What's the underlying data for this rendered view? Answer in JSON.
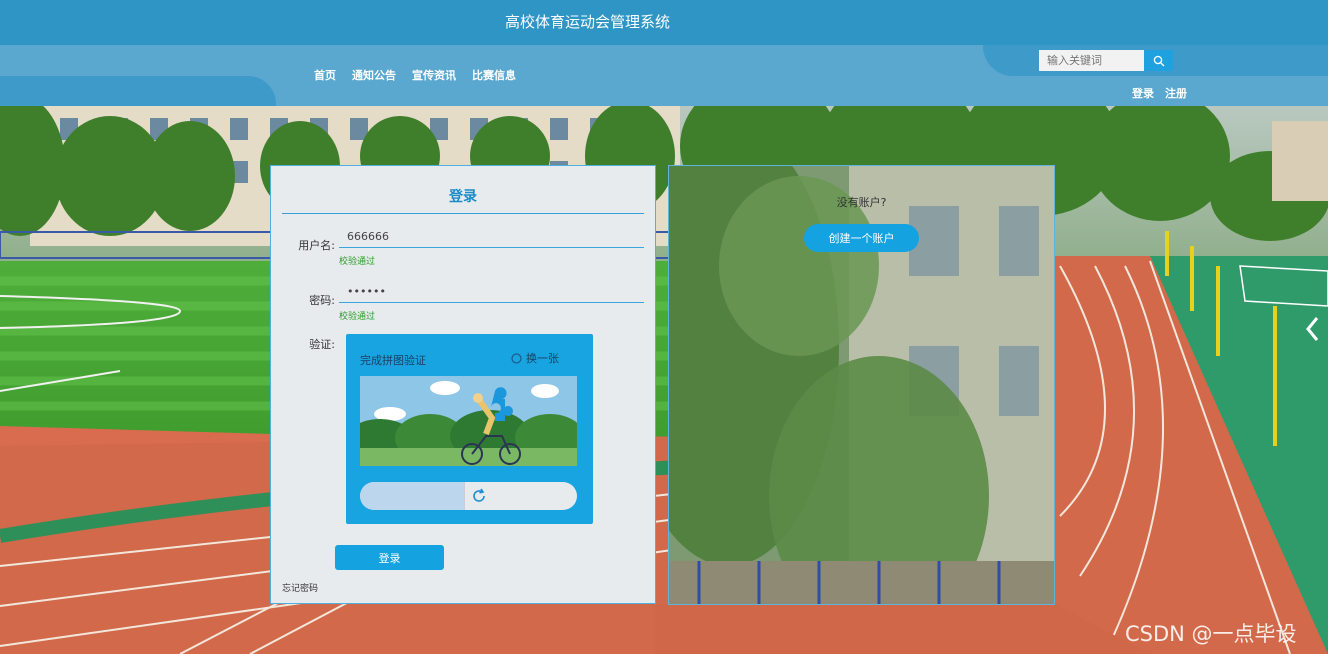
{
  "header": {
    "title": "高校体育运动会管理系统",
    "nav": [
      "首页",
      "通知公告",
      "宣传资讯",
      "比赛信息"
    ],
    "search_placeholder": "输入关键词",
    "login_link": "登录",
    "register_link": "注册"
  },
  "login": {
    "title": "登录",
    "username_label": "用户名:",
    "username_value": "666666",
    "username_status": "校验通过",
    "password_label": "密码:",
    "password_value": "666666",
    "password_status": "校验通过",
    "verify_label": "验证:",
    "captcha": {
      "hint": "完成拼图验证",
      "refresh_label": "换一张",
      "slider_progress": 0.55
    },
    "submit_label": "登录",
    "forgot_label": "忘记密码"
  },
  "signup_panel": {
    "question": "没有账户?",
    "create_label": "创建一个账户"
  },
  "watermark": "CSDN @一点毕设",
  "colors": {
    "header_dark": "#2e95c4",
    "header_light": "#5aa7cf",
    "accent": "#14a2e0",
    "success": "#2e9a2e"
  }
}
